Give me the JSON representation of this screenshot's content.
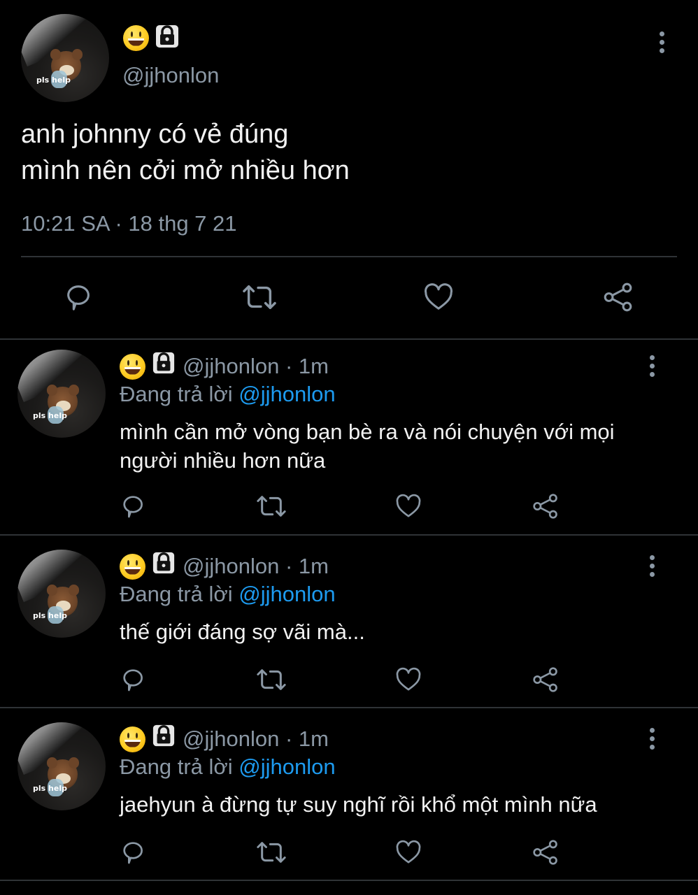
{
  "main_tweet": {
    "avatar_label": "pls help",
    "name_icons": [
      "grinning-face-emoji",
      "lock-icon"
    ],
    "handle": "@jjhonlon",
    "text_line1": "anh johnny có vẻ đúng",
    "text_line2": "mình nên cởi mở nhiều hơn",
    "timestamp": "10:21 SA · 18 thg 7 21",
    "actions": [
      "reply-icon",
      "retweet-icon",
      "like-icon",
      "share-icon"
    ]
  },
  "replies": [
    {
      "avatar_label": "pls help",
      "handle_time": "@jjhonlon · 1m",
      "replying_prefix": "Đang trả lời",
      "replying_to": "@jjhonlon",
      "text": "mình cần mở vòng bạn bè ra và nói chuyện với mọi người nhiều hơn nữa"
    },
    {
      "avatar_label": "pls help",
      "handle_time": "@jjhonlon · 1m",
      "replying_prefix": "Đang trả lời",
      "replying_to": "@jjhonlon",
      "text": "thế giới đáng sợ vãi mà..."
    },
    {
      "avatar_label": "pls help",
      "handle_time": "@jjhonlon · 1m",
      "replying_prefix": "Đang trả lời",
      "replying_to": "@jjhonlon",
      "text": "jaehyun à đừng tự suy nghĩ rồi khổ một mình nữa"
    }
  ],
  "colors": {
    "background": "#000000",
    "text": "#f2f2f2",
    "secondary": "#8b98a5",
    "link": "#1d9bf0",
    "divider": "#2f3336"
  }
}
